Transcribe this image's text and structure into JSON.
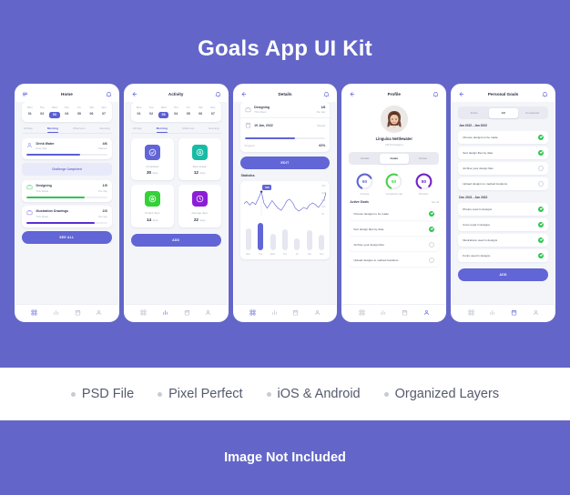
{
  "kit": {
    "title": "Goals App UI Kit",
    "footer_note": "Image Not Included",
    "accent": "#6165d6",
    "background": "#6366c8"
  },
  "features": [
    {
      "label": "PSD File"
    },
    {
      "label": "Pixel Perfect"
    },
    {
      "label": "iOS & Android"
    },
    {
      "label": "Organized Layers"
    }
  ],
  "week": {
    "days": [
      {
        "name": "Mon",
        "num": "01",
        "selected": false
      },
      {
        "name": "Tue",
        "num": "02",
        "selected": false
      },
      {
        "name": "Wed",
        "num": "03",
        "selected": true
      },
      {
        "name": "Thu",
        "num": "04",
        "selected": false
      },
      {
        "name": "Fri",
        "num": "05",
        "selected": false
      },
      {
        "name": "Sat",
        "num": "06",
        "selected": false
      },
      {
        "name": "Sun",
        "num": "07",
        "selected": false
      }
    ]
  },
  "daypart_tabs": [
    {
      "label": "All Day",
      "selected": false
    },
    {
      "label": "Morning",
      "selected": true
    },
    {
      "label": "Afternoon",
      "selected": false
    },
    {
      "label": "Evening",
      "selected": false
    }
  ],
  "home": {
    "title": "Home",
    "menu_icon": "hamburger-icon",
    "bell_icon": "bell-icon",
    "goals": [
      {
        "name": "Drink Water",
        "sub": "Everyday",
        "value": "4/6",
        "unit": "Glasses",
        "progress": 66,
        "color": "#5b5fd4",
        "icon": "water-drop-icon"
      },
      {
        "name": "Designing",
        "sub": "This Week",
        "value": "1/5",
        "unit": "Per day",
        "progress": 72,
        "color": "#2dc653",
        "icon": "briefcase-icon"
      },
      {
        "name": "Illustration Drawings",
        "sub": "This Week",
        "value": "2/3",
        "unit": "Per day",
        "progress": 84,
        "color": "#5b2fd4",
        "icon": "briefcase-icon"
      }
    ],
    "challenge_banner": "Challenge Completed",
    "see_all_button": "SEE ALL"
  },
  "activity": {
    "title": "Activity",
    "back_icon": "back-arrow-icon",
    "bell_icon": "bell-icon",
    "stats": [
      {
        "label": "Completed",
        "value": "30",
        "unit": "days",
        "color": "#6165d6",
        "icon": "check-circle-icon"
      },
      {
        "label": "Best streak",
        "value": "12",
        "unit": "days",
        "color": "#18bba4",
        "icon": "fire-icon"
      },
      {
        "label": "Perfect days",
        "value": "14",
        "unit": "days",
        "color": "#34d138",
        "icon": "star-circle-icon"
      },
      {
        "label": "Average days",
        "value": "22",
        "unit": "days",
        "color": "#8b1fd6",
        "icon": "clock-icon"
      }
    ],
    "add_button": "ADD"
  },
  "details": {
    "title": "Details",
    "back_icon": "back-arrow-icon",
    "bell_icon": "bell-icon",
    "goal_name": "Designing",
    "goal_sub": "This Week",
    "goal_value": "1/6",
    "goal_unit": "Per day",
    "date": "19 Jan, 2022",
    "date_sub": "Weekly",
    "progress_label": "Progress",
    "progress_value": "62%",
    "progress_pct": 62,
    "edit_button": "EDIT",
    "statistics_label": "Statistics",
    "tooltip_value": "198",
    "chart_data": {
      "type": "line",
      "title": "Statistics",
      "ytick_labels": [
        "250",
        "200",
        "150",
        "100",
        "50"
      ],
      "ylim": [
        0,
        250
      ],
      "grid": false,
      "legend": "none",
      "x": [
        0,
        1,
        2,
        3,
        4,
        5,
        6,
        7,
        8,
        9,
        10,
        11,
        12,
        13,
        14,
        15,
        16,
        17,
        18,
        19,
        20,
        21,
        22,
        23,
        24,
        25,
        26,
        27,
        28,
        29
      ],
      "values": [
        150,
        168,
        140,
        162,
        148,
        175,
        198,
        150,
        118,
        140,
        160,
        138,
        120,
        105,
        128,
        158,
        165,
        150,
        122,
        100,
        112,
        128,
        118,
        138,
        150,
        142,
        128,
        140,
        168,
        205
      ],
      "highlight_index": 6,
      "highlight_value": 198
    },
    "bar_chart": {
      "type": "bar",
      "categories": [
        "Mon",
        "Tue",
        "Wed",
        "Thu",
        "Fri",
        "Sat",
        "Sun"
      ],
      "values": [
        72,
        88,
        55,
        68,
        40,
        66,
        50
      ],
      "ylim": [
        0,
        100
      ],
      "highlight_index": 1,
      "highlight_color": "#6165d6",
      "bar_color": "#e6e7f0",
      "grid": false
    }
  },
  "profile": {
    "title": "Profile",
    "back_icon": "back-arrow-icon",
    "bell_icon": "bell-icon",
    "avatar": "user-photo",
    "name": "Linguina Nettlewater",
    "role": "UI/UX Designer",
    "tabs": [
      {
        "label": "Details",
        "selected": false
      },
      {
        "label": "Goals",
        "selected": true
      },
      {
        "label": "Rodes",
        "selected": false
      }
    ],
    "gauges": [
      {
        "label": "Overdue",
        "value": "60",
        "pct": 60,
        "color": "#6165d6"
      },
      {
        "label": "Completion rate",
        "value": "50",
        "pct": 50,
        "color": "#4ad14d"
      },
      {
        "label": "Precision",
        "value": "80",
        "pct": 80,
        "color": "#7322c9"
      }
    ],
    "active_goals_label": "Active Goals",
    "see_all": "See All",
    "tasks": [
      {
        "label": "Choose designs to be made",
        "done": true
      },
      {
        "label": "Sort design files by date",
        "done": true
      },
      {
        "label": "Archive your design files",
        "done": false
      },
      {
        "label": "Upload designs to marked locations",
        "done": false
      }
    ]
  },
  "personal_goals": {
    "title": "Personal Goals",
    "back_icon": "back-arrow-icon",
    "bell_icon": "bell-icon",
    "tabs": [
      {
        "label": "Active",
        "selected": false
      },
      {
        "label": "All",
        "selected": true
      },
      {
        "label": "Completed",
        "selected": false
      }
    ],
    "groups": [
      {
        "date_range": "Jan 2022 - Jan 2022",
        "tasks": [
          {
            "label": "Choose designs to be made",
            "done": true
          },
          {
            "label": "Sort design files by date",
            "done": true
          },
          {
            "label": "Archive your design files",
            "done": false
          },
          {
            "label": "Upload designs to marked locations",
            "done": false
          }
        ]
      },
      {
        "date_range": "Dec 2021 - Jan 2022",
        "tasks": [
          {
            "label": "Photos used in designs",
            "done": true
          },
          {
            "label": "Icons used in designs",
            "done": true
          },
          {
            "label": "Illustrations used in designs",
            "done": true
          },
          {
            "label": "Fonts used in designs",
            "done": true
          }
        ]
      }
    ],
    "add_button": "ADD"
  },
  "bottom_nav": [
    {
      "icon": "grid-dashboard-icon",
      "active": true
    },
    {
      "icon": "bar-chart-icon",
      "active": false
    },
    {
      "icon": "calendar-icon",
      "active": false
    },
    {
      "icon": "person-icon",
      "active": false
    }
  ]
}
